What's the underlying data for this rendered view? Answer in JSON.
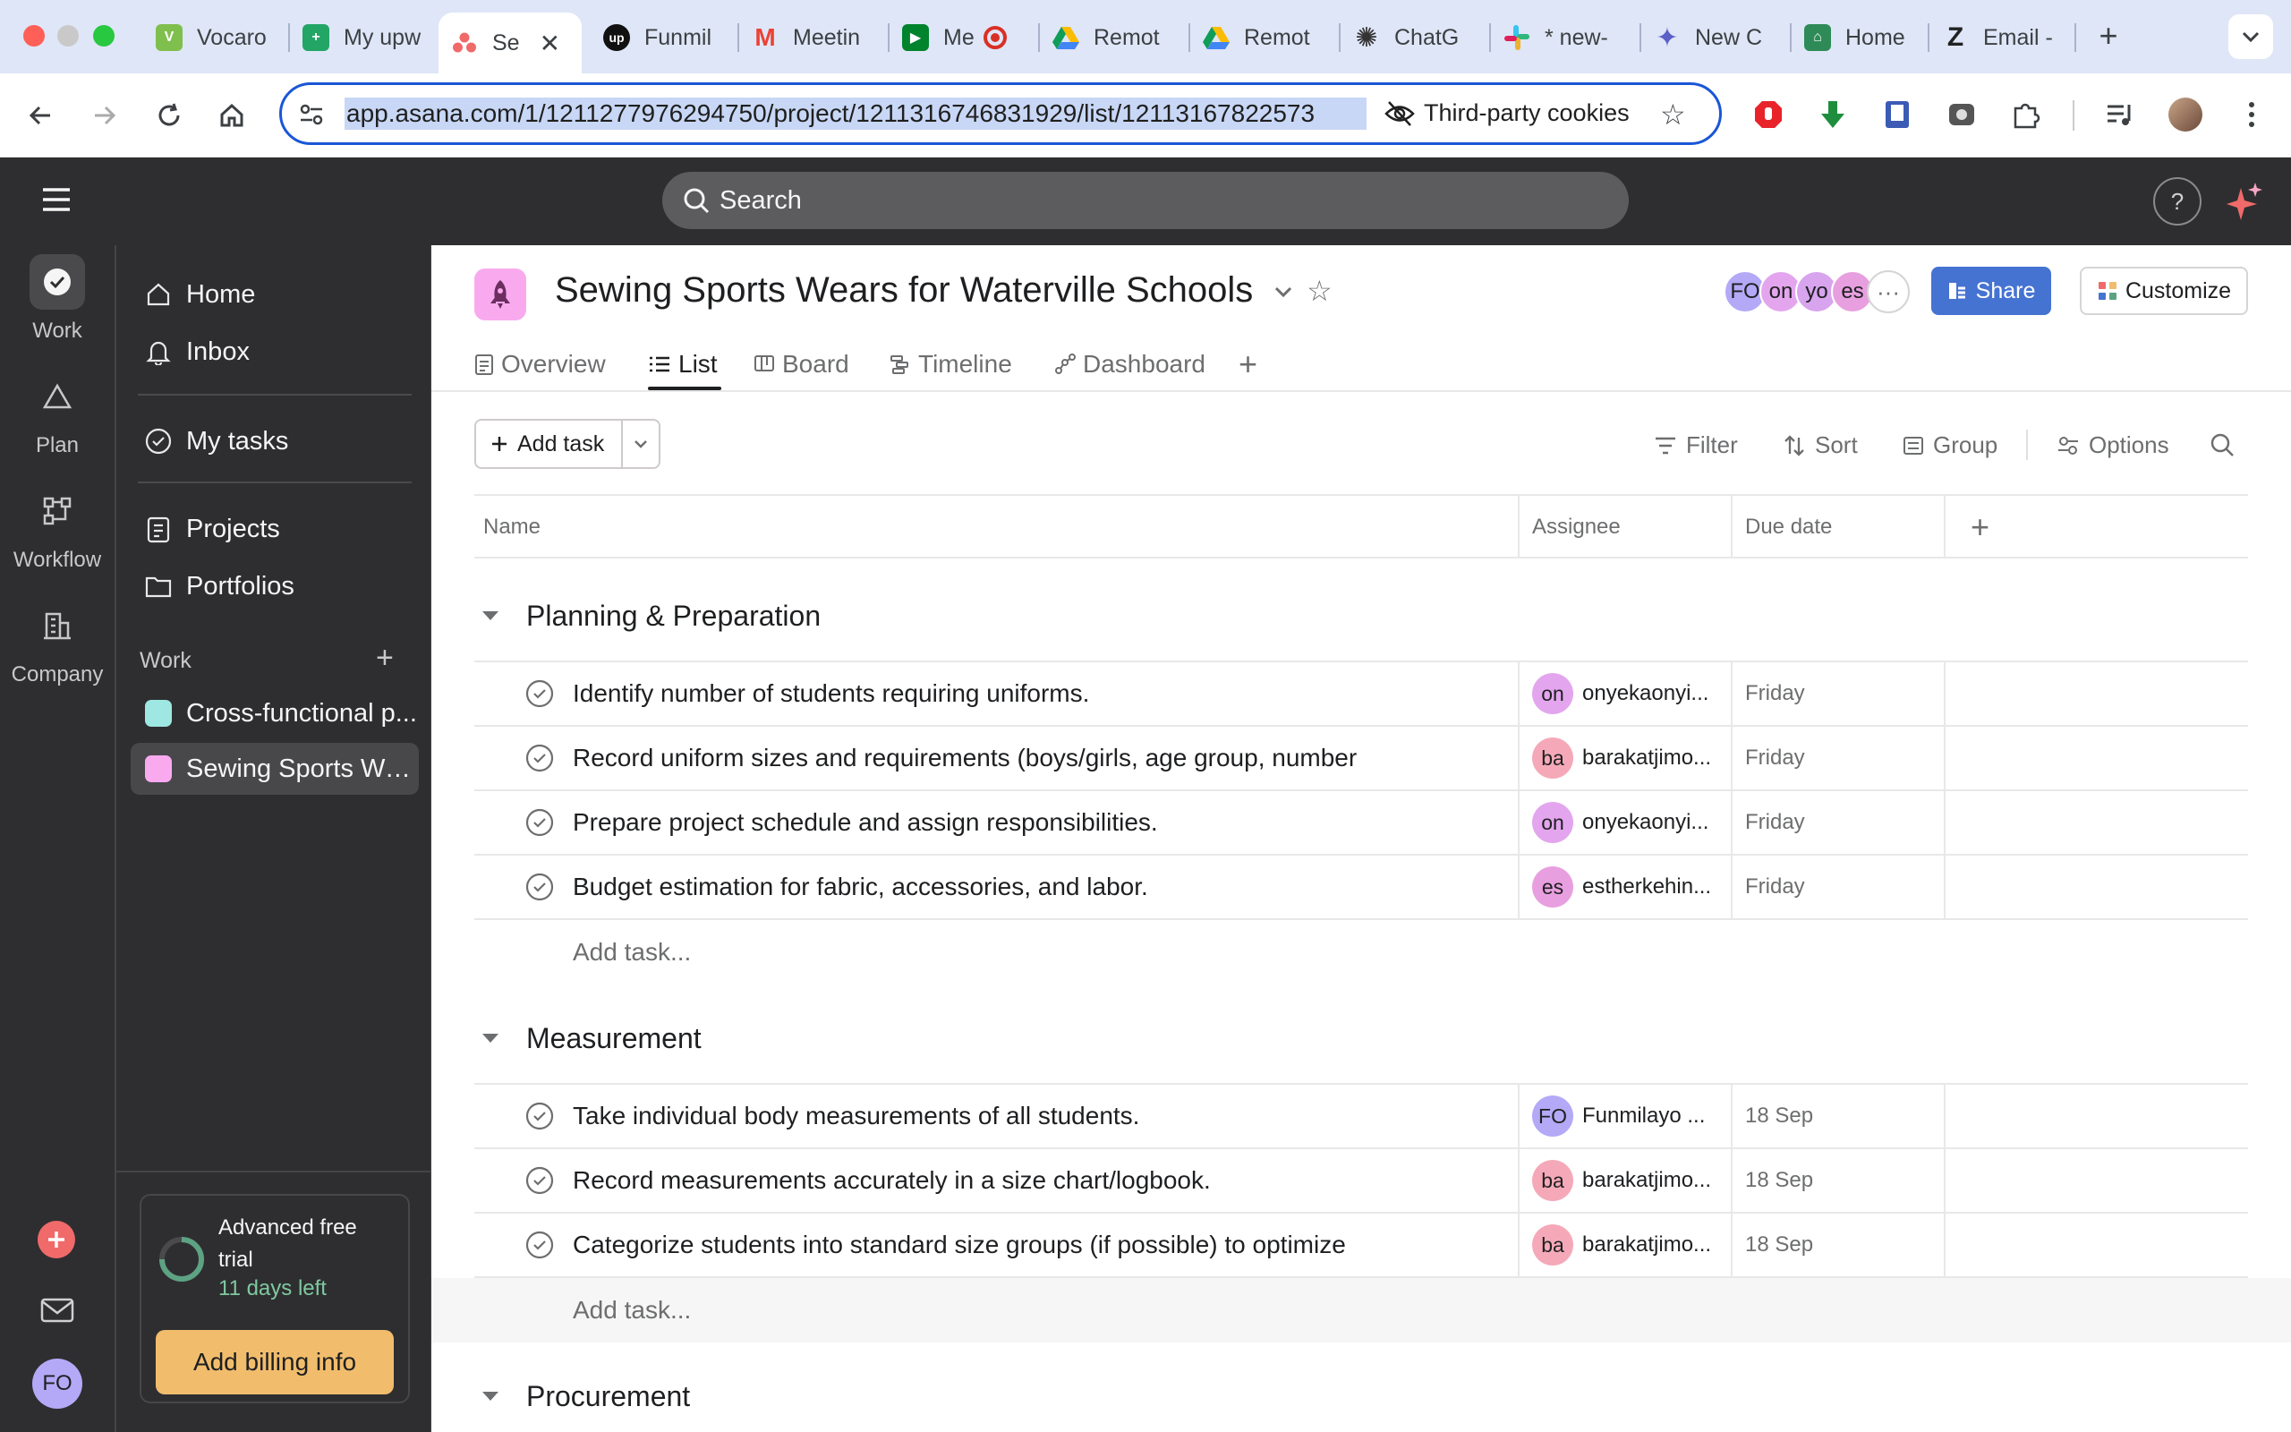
{
  "browser": {
    "tabs": [
      {
        "label": "Vocaro",
        "fav_color": "#7fbf4d",
        "fav_glyph": "V"
      },
      {
        "label": "My upw",
        "fav_color": "#23a566",
        "fav_glyph": "+"
      },
      {
        "label": "Se",
        "fav_color": "#f06a6a",
        "fav_glyph": "∴",
        "active": true
      },
      {
        "label": "Funmil",
        "fav_color": "#111111",
        "fav_glyph": "up"
      },
      {
        "label": "Meetin",
        "fav_color": "#ea4335",
        "fav_glyph": "M"
      },
      {
        "label": "Me",
        "fav_color": "#00832d",
        "fav_glyph": "▶"
      },
      {
        "label": "Remot",
        "fav_color": "#fbbc04",
        "fav_glyph": "▲"
      },
      {
        "label": "Remot",
        "fav_color": "#fbbc04",
        "fav_glyph": "▲"
      },
      {
        "label": "ChatG",
        "fav_color": "#444444",
        "fav_glyph": "✺"
      },
      {
        "label": "* new-",
        "fav_color": "#e01e5a",
        "fav_glyph": "#"
      },
      {
        "label": "New C",
        "fav_color": "#5b5fc7",
        "fav_glyph": "✦"
      },
      {
        "label": "Home",
        "fav_color": "#2e8b57",
        "fav_glyph": "⌂"
      },
      {
        "label": "Email -",
        "fav_color": "#333333",
        "fav_glyph": "Z"
      }
    ],
    "url": "app.asana.com/1/1211277976294750/project/1211316746831929/list/12113167822573",
    "cookies_label": "Third-party cookies"
  },
  "topbar": {
    "search_placeholder": "Search",
    "help": "?"
  },
  "rail": {
    "items": [
      {
        "label": "Work",
        "icon": "check-circle-icon"
      },
      {
        "label": "Plan",
        "icon": "triangle-icon"
      },
      {
        "label": "Workflow",
        "icon": "workflow-icon"
      },
      {
        "label": "Company",
        "icon": "building-icon"
      }
    ],
    "user_initials": "FO"
  },
  "sidebar": {
    "items": [
      {
        "label": "Home",
        "icon": "home-icon"
      },
      {
        "label": "Inbox",
        "icon": "bell-icon"
      },
      {
        "label": "My tasks",
        "icon": "check-circle-icon"
      },
      {
        "label": "Projects",
        "icon": "clipboard-icon"
      },
      {
        "label": "Portfolios",
        "icon": "folder-icon"
      }
    ],
    "work_heading": "Work",
    "projects": [
      {
        "label": "Cross-functional p...",
        "color": "#9ee7e3"
      },
      {
        "label": "Sewing Sports We...",
        "color": "#f9aaef"
      }
    ],
    "trial": {
      "title": "Advanced free trial",
      "days_left": "11 days left",
      "button": "Add billing info"
    }
  },
  "project": {
    "title": "Sewing Sports Wears for Waterville Schools",
    "tabs": [
      {
        "label": "Overview"
      },
      {
        "label": "List"
      },
      {
        "label": "Board"
      },
      {
        "label": "Timeline"
      },
      {
        "label": "Dashboard"
      }
    ],
    "members": [
      {
        "initials": "FO",
        "color": "#b4a9f7"
      },
      {
        "initials": "on",
        "color": "#e3a6ee"
      },
      {
        "initials": "yo",
        "color": "#d8a4ee"
      },
      {
        "initials": "es",
        "color": "#e89fdf"
      }
    ],
    "share_label": "Share",
    "customize_label": "Customize"
  },
  "toolbar": {
    "add_task": "Add task",
    "filter": "Filter",
    "sort": "Sort",
    "group": "Group",
    "options": "Options"
  },
  "columns": {
    "name": "Name",
    "assignee": "Assignee",
    "due": "Due date"
  },
  "sections": [
    {
      "title": "Planning & Preparation",
      "tasks": [
        {
          "name": "Identify number of students requiring uniforms.",
          "assignee_initials": "on",
          "assignee": "onyekaonyi...",
          "av_color": "#e3a6ee",
          "due": "Friday"
        },
        {
          "name": "Record uniform sizes and requirements (boys/girls, age group, number",
          "assignee_initials": "ba",
          "assignee": "barakatjimo...",
          "av_color": "#f5a9b8",
          "due": "Friday"
        },
        {
          "name": "Prepare project schedule and assign responsibilities.",
          "assignee_initials": "on",
          "assignee": "onyekaonyi...",
          "av_color": "#e3a6ee",
          "due": "Friday"
        },
        {
          "name": "Budget estimation for fabric, accessories, and labor.",
          "assignee_initials": "es",
          "assignee": "estherkehin...",
          "av_color": "#e89fdf",
          "due": "Friday"
        }
      ],
      "add_task": "Add task..."
    },
    {
      "title": "Measurement",
      "tasks": [
        {
          "name": "Take individual body measurements of all students.",
          "assignee_initials": "FO",
          "assignee": "Funmilayo ...",
          "av_color": "#b4a9f7",
          "due": "18 Sep"
        },
        {
          "name": "Record measurements accurately in a size chart/logbook.",
          "assignee_initials": "ba",
          "assignee": "barakatjimo...",
          "av_color": "#f5a9b8",
          "due": "18 Sep"
        },
        {
          "name": "Categorize students into standard size groups (if possible) to optimize",
          "assignee_initials": "ba",
          "assignee": "barakatjimo...",
          "av_color": "#f5a9b8",
          "due": "18 Sep"
        }
      ],
      "add_task": "Add task..."
    },
    {
      "title": "Procurement",
      "tasks": []
    }
  ]
}
